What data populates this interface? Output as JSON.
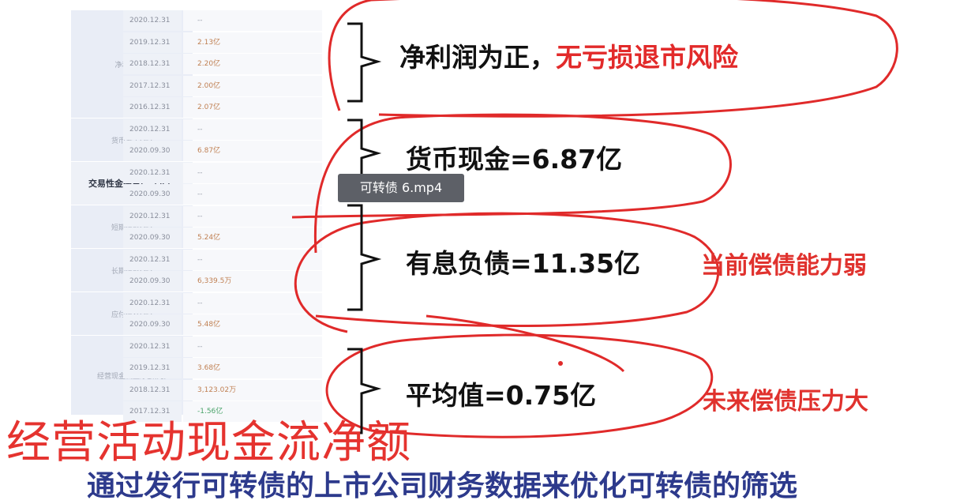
{
  "video_tooltip": "可转债 6.mp4",
  "table": {
    "labels": {
      "net_profit": "净利润(元)",
      "cash": "货币资金(元)",
      "trading_assets": "交易性金融资产（元）",
      "short_loan": "短期借款(元)",
      "long_loan": "长期借款(元)",
      "bonds_payable": "应付债券(元)",
      "op_cash_flow": "经营现金流量净额(元)"
    },
    "rows": [
      {
        "date": "2020.12.31",
        "value": "--"
      },
      {
        "date": "2019.12.31",
        "value": "2.13亿"
      },
      {
        "date": "2018.12.31",
        "value": "2.20亿"
      },
      {
        "date": "2017.12.31",
        "value": "2.00亿"
      },
      {
        "date": "2016.12.31",
        "value": "2.07亿"
      },
      {
        "date": "2020.12.31",
        "value": "--"
      },
      {
        "date": "2020.09.30",
        "value": "6.87亿"
      },
      {
        "date": "2020.12.31",
        "value": "--"
      },
      {
        "date": "2020.09.30",
        "value": "--"
      },
      {
        "date": "2020.12.31",
        "value": "--"
      },
      {
        "date": "2020.09.30",
        "value": "5.24亿"
      },
      {
        "date": "2020.12.31",
        "value": "--"
      },
      {
        "date": "2020.09.30",
        "value": "6,339.5万"
      },
      {
        "date": "2020.12.31",
        "value": "--"
      },
      {
        "date": "2020.09.30",
        "value": "5.48亿"
      },
      {
        "date": "2020.12.31",
        "value": "--"
      },
      {
        "date": "2019.12.31",
        "value": "3.68亿"
      },
      {
        "date": "2018.12.31",
        "value": "3,123.02万"
      },
      {
        "date": "2017.12.31",
        "value": "-1.56亿"
      }
    ]
  },
  "annotations": {
    "net_profit_note": "净利润为正，",
    "net_profit_note_red": "无亏损退市风险",
    "cash_note": "货币现金=6.87亿",
    "debt_note": "有息负债=11.35亿",
    "debt_side": "当前偿债能力弱",
    "avg_note": "平均值=0.75亿",
    "avg_side": "未来偿债压力大"
  },
  "captions": {
    "red": "经营活动现金流净额",
    "blue": "通过发行可转债的上市公司财务数据来优化可转债的筛选"
  },
  "colors": {
    "ink_red": "#e22a2a",
    "caption_blue": "#2d3a8c",
    "table_bg": "#eef1f7",
    "negative_value": "#4aa36a",
    "positive_value": "#c08053"
  }
}
